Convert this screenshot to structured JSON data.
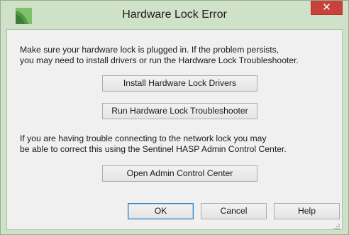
{
  "window": {
    "title": "Hardware Lock Error",
    "close_glyph": "✕",
    "app_icon": "chief-architect-icon"
  },
  "dialog": {
    "message1_line1": "Make sure your hardware lock is plugged in. If the problem persists,",
    "message1_line2": "you may need to install drivers or run the Hardware Lock Troubleshooter.",
    "install_drivers_label": "Install Hardware Lock Drivers",
    "troubleshooter_label": "Run Hardware Lock Troubleshooter",
    "message2_line1": "If you are having trouble connecting to the network lock you may",
    "message2_line2": "be able to correct this using the Sentinel HASP Admin Control Center.",
    "admin_center_label": "Open Admin Control Center"
  },
  "footer": {
    "ok_label": "OK",
    "cancel_label": "Cancel",
    "help_label": "Help"
  },
  "colors": {
    "frame": "#cfe1c8",
    "close": "#c8413a",
    "client": "#f0f0f0",
    "default_button_border": "#3c7fb1"
  }
}
